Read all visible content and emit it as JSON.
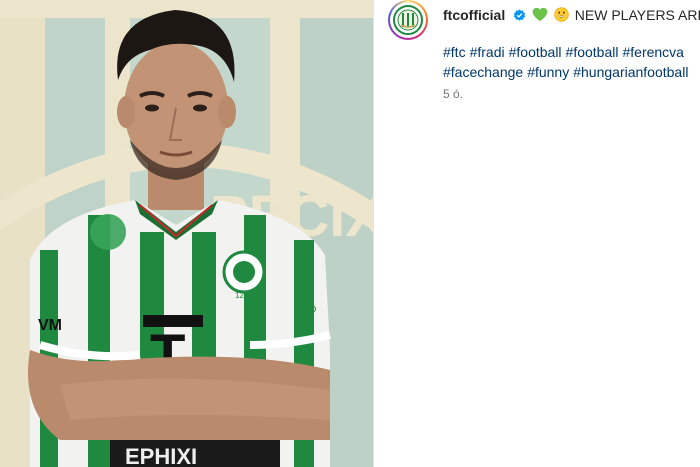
{
  "post": {
    "username": "ftcofficial",
    "caption": "NEW PLAYERS ARE CO",
    "hashtags_line1": [
      "#ftc",
      "#fradi",
      "#football",
      "#football",
      "#ferencva"
    ],
    "hashtags_line2": [
      "#facechange",
      "#funny",
      "#hungarianfootball"
    ],
    "timestamp": "5 ó."
  },
  "image": {
    "background_text": "PEČIX",
    "shirt_sponsor": "T",
    "shirt_left_logo": "VM",
    "shirt_right_logo": "Gro",
    "crest_number": "125",
    "bottom_text": "EPHIXI"
  },
  "colors": {
    "hashtag": "#00376b",
    "verified": "#0095f6",
    "shirt_green": "#1f8a3f"
  },
  "icons": [
    "verified-icon",
    "green-heart-icon",
    "grinning-face-icon"
  ]
}
